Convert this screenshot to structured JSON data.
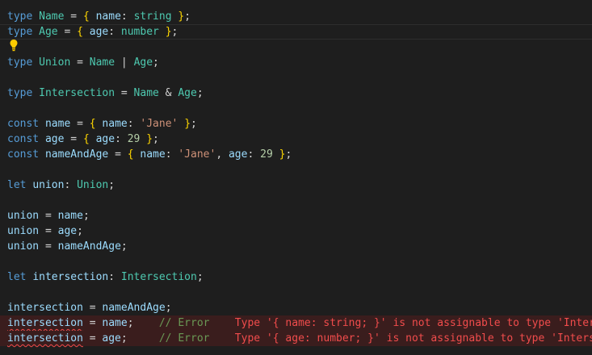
{
  "lines": [
    [
      {
        "t": "type",
        "c": "kw"
      },
      {
        "t": " "
      },
      {
        "t": "Name",
        "c": "ty"
      },
      {
        "t": " = "
      },
      {
        "t": "{",
        "c": "br"
      },
      {
        "t": " "
      },
      {
        "t": "name",
        "c": "var"
      },
      {
        "t": ": "
      },
      {
        "t": "string",
        "c": "ty"
      },
      {
        "t": " "
      },
      {
        "t": "}",
        "c": "br"
      },
      {
        "t": ";"
      }
    ],
    [
      {
        "t": "type",
        "c": "kw"
      },
      {
        "t": " "
      },
      {
        "t": "Age",
        "c": "ty"
      },
      {
        "t": " = "
      },
      {
        "t": "{",
        "c": "br"
      },
      {
        "t": " "
      },
      {
        "t": "age",
        "c": "var"
      },
      {
        "t": ": "
      },
      {
        "t": "number",
        "c": "ty"
      },
      {
        "t": " "
      },
      {
        "t": "}",
        "c": "br"
      },
      {
        "t": ";"
      }
    ],
    [],
    [
      {
        "t": "type",
        "c": "kw"
      },
      {
        "t": " "
      },
      {
        "t": "Union",
        "c": "ty"
      },
      {
        "t": " = "
      },
      {
        "t": "Name",
        "c": "ty"
      },
      {
        "t": " | "
      },
      {
        "t": "Age",
        "c": "ty"
      },
      {
        "t": ";"
      }
    ],
    [],
    [
      {
        "t": "type",
        "c": "kw"
      },
      {
        "t": " "
      },
      {
        "t": "Intersection",
        "c": "ty"
      },
      {
        "t": " = "
      },
      {
        "t": "Name",
        "c": "ty"
      },
      {
        "t": " & "
      },
      {
        "t": "Age",
        "c": "ty"
      },
      {
        "t": ";"
      }
    ],
    [],
    [
      {
        "t": "const",
        "c": "kw"
      },
      {
        "t": " "
      },
      {
        "t": "name",
        "c": "var"
      },
      {
        "t": " = "
      },
      {
        "t": "{",
        "c": "br"
      },
      {
        "t": " "
      },
      {
        "t": "name",
        "c": "var"
      },
      {
        "t": ": "
      },
      {
        "t": "'Jane'",
        "c": "str"
      },
      {
        "t": " "
      },
      {
        "t": "}",
        "c": "br"
      },
      {
        "t": ";"
      }
    ],
    [
      {
        "t": "const",
        "c": "kw"
      },
      {
        "t": " "
      },
      {
        "t": "age",
        "c": "var"
      },
      {
        "t": " = "
      },
      {
        "t": "{",
        "c": "br"
      },
      {
        "t": " "
      },
      {
        "t": "age",
        "c": "var"
      },
      {
        "t": ": "
      },
      {
        "t": "29",
        "c": "num"
      },
      {
        "t": " "
      },
      {
        "t": "}",
        "c": "br"
      },
      {
        "t": ";"
      }
    ],
    [
      {
        "t": "const",
        "c": "kw"
      },
      {
        "t": " "
      },
      {
        "t": "nameAndAge",
        "c": "var"
      },
      {
        "t": " = "
      },
      {
        "t": "{",
        "c": "br"
      },
      {
        "t": " "
      },
      {
        "t": "name",
        "c": "var"
      },
      {
        "t": ": "
      },
      {
        "t": "'Jane'",
        "c": "str"
      },
      {
        "t": ", "
      },
      {
        "t": "age",
        "c": "var"
      },
      {
        "t": ": "
      },
      {
        "t": "29",
        "c": "num"
      },
      {
        "t": " "
      },
      {
        "t": "}",
        "c": "br"
      },
      {
        "t": ";"
      }
    ],
    [],
    [
      {
        "t": "let",
        "c": "kw"
      },
      {
        "t": " "
      },
      {
        "t": "union",
        "c": "var"
      },
      {
        "t": ": "
      },
      {
        "t": "Union",
        "c": "ty"
      },
      {
        "t": ";"
      }
    ],
    [],
    [
      {
        "t": "union",
        "c": "var"
      },
      {
        "t": " = "
      },
      {
        "t": "name",
        "c": "var"
      },
      {
        "t": ";"
      }
    ],
    [
      {
        "t": "union",
        "c": "var"
      },
      {
        "t": " = "
      },
      {
        "t": "age",
        "c": "var"
      },
      {
        "t": ";"
      }
    ],
    [
      {
        "t": "union",
        "c": "var"
      },
      {
        "t": " = "
      },
      {
        "t": "nameAndAge",
        "c": "var"
      },
      {
        "t": ";"
      }
    ],
    [],
    [
      {
        "t": "let",
        "c": "kw"
      },
      {
        "t": " "
      },
      {
        "t": "intersection",
        "c": "var"
      },
      {
        "t": ": "
      },
      {
        "t": "Intersection",
        "c": "ty"
      },
      {
        "t": ";"
      }
    ],
    [],
    [
      {
        "t": "intersection",
        "c": "var"
      },
      {
        "t": " = "
      },
      {
        "t": "nameAndAge",
        "c": "var"
      },
      {
        "t": ";"
      }
    ],
    [
      {
        "t": "intersection",
        "c": "var squiggle"
      },
      {
        "t": " = "
      },
      {
        "t": "name",
        "c": "var"
      },
      {
        "t": ";    "
      },
      {
        "t": "// Error",
        "c": "cm"
      },
      {
        "t": "    "
      },
      {
        "t": "Type '{ name: string; }' is not assignable to type 'Intersection'.",
        "c": "err-msg"
      }
    ],
    [
      {
        "t": "intersection",
        "c": "var squiggle"
      },
      {
        "t": " = "
      },
      {
        "t": "age",
        "c": "var"
      },
      {
        "t": ";     "
      },
      {
        "t": "// Error",
        "c": "cm"
      },
      {
        "t": "    "
      },
      {
        "t": "Type '{ age: number; }' is not assignable to type 'Intersection'.",
        "c": "err-msg"
      }
    ]
  ],
  "current_line": 1,
  "error_lines": [
    20,
    21
  ],
  "bulb_icon": "lightbulb-icon"
}
